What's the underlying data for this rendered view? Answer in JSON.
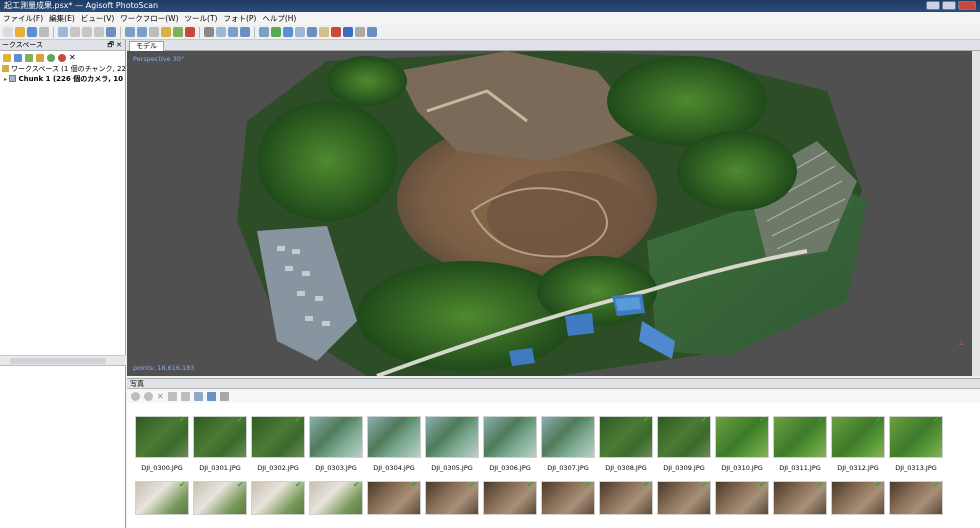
{
  "window": {
    "title": "起工測量成果.psx* — Agisoft PhotoScan"
  },
  "menu": [
    "ファイル(F)",
    "編集(E)",
    "ビュー(V)",
    "ワークフロー(W)",
    "ツール(T)",
    "フォト(P)",
    "ヘルプ(H)"
  ],
  "workspace": {
    "header": "ークスペース",
    "root_label": "ワークスペース (1 個のチャンク, 226 個",
    "chunk_label": "Chunk 1 (226 個のカメラ, 10 マー"
  },
  "model": {
    "tab_label": "モデル",
    "perspective_label": "Perspective 30°",
    "points_label": "points: 18,616,183"
  },
  "photos": {
    "header": "写真",
    "row1": [
      {
        "label": "DJI_0300.JPG",
        "tone": "forest"
      },
      {
        "label": "DJI_0301.JPG",
        "tone": "forest"
      },
      {
        "label": "DJI_0302.JPG",
        "tone": "forest"
      },
      {
        "label": "DJI_0303.JPG",
        "tone": "road"
      },
      {
        "label": "DJI_0304.JPG",
        "tone": "road"
      },
      {
        "label": "DJI_0305.JPG",
        "tone": "road"
      },
      {
        "label": "DJI_0306.JPG",
        "tone": "road"
      },
      {
        "label": "DJI_0307.JPG",
        "tone": "road"
      },
      {
        "label": "DJI_0308.JPG",
        "tone": "forest"
      },
      {
        "label": "DJI_0309.JPG",
        "tone": "forest"
      },
      {
        "label": "DJI_0310.JPG",
        "tone": "green"
      },
      {
        "label": "DJI_0311.JPG",
        "tone": "green"
      },
      {
        "label": "DJI_0312.JPG",
        "tone": "green"
      },
      {
        "label": "DJI_0313.JPG",
        "tone": "green"
      }
    ],
    "row2_tones": [
      "light",
      "light",
      "light",
      "light",
      "dirt",
      "dirt",
      "dirt",
      "dirt",
      "dirt",
      "dirt",
      "dirt",
      "dirt",
      "dirt",
      "dirt"
    ]
  },
  "colors": {
    "title_bg": "#1e3b63",
    "viewport_bg": "#505050",
    "check": "#33aa33",
    "label_blue": "#88aaff"
  }
}
